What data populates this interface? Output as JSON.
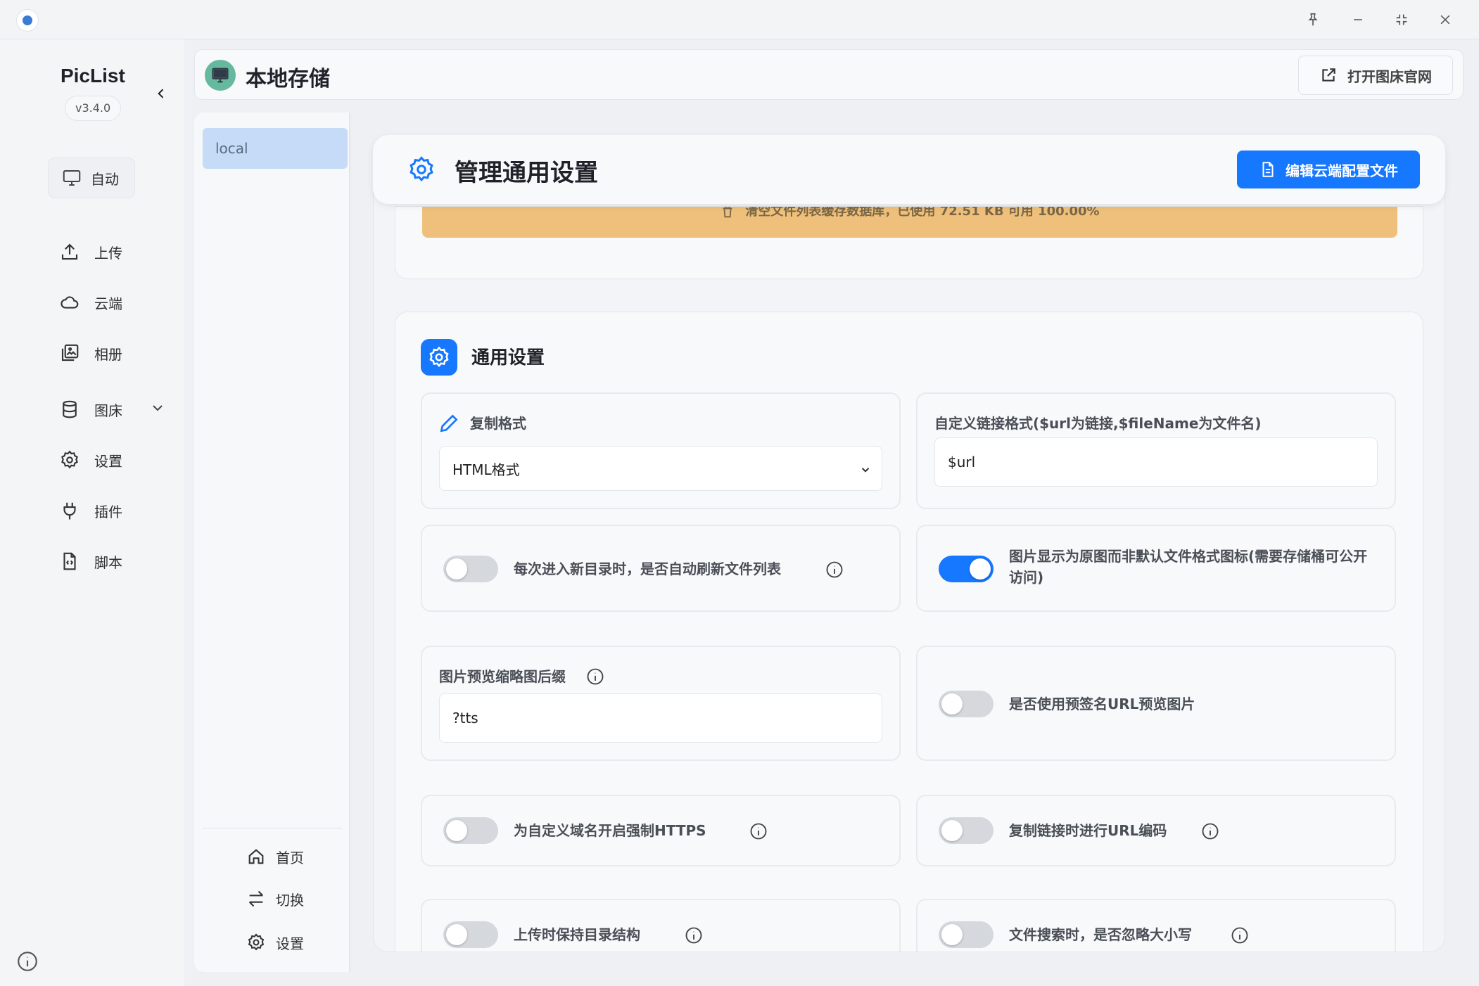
{
  "app": {
    "name": "PicList",
    "version": "v3.4.0",
    "mode_button": "自动"
  },
  "sidebar": {
    "items": [
      {
        "label": "上传",
        "icon": "upload-icon"
      },
      {
        "label": "云端",
        "icon": "cloud-icon"
      },
      {
        "label": "相册",
        "icon": "gallery-icon"
      },
      {
        "label": "图床",
        "icon": "database-icon"
      },
      {
        "label": "设置",
        "icon": "gear-icon"
      },
      {
        "label": "插件",
        "icon": "plug-icon"
      },
      {
        "label": "脚本",
        "icon": "script-icon"
      }
    ]
  },
  "header": {
    "title": "本地存储",
    "open_site_button": "打开图床官网"
  },
  "storage_list": {
    "items": [
      "local"
    ],
    "bottom_buttons": [
      "首页",
      "切换",
      "设置"
    ]
  },
  "main": {
    "title": "管理通用设置",
    "edit_button": "编辑云端配置文件",
    "cache_notice": "清空文件列表缓存数据库，已使用 72.51 KB 可用 100.00%",
    "general": {
      "title": "通用设置",
      "copy_format": {
        "label": "复制格式",
        "value": "HTML格式"
      },
      "custom_link": {
        "label": "自定义链接格式($url为链接,$fileName为文件名)",
        "value": "$url"
      },
      "toggles": {
        "auto_refresh": {
          "label": "每次进入新目录时，是否自动刷新文件列表",
          "on": false
        },
        "show_original": {
          "label": "图片显示为原图而非默认文件格式图标(需要存储桶可公开访问)",
          "on": true
        },
        "presigned": {
          "label": "是否使用预签名URL预览图片",
          "on": false
        },
        "force_https": {
          "label": "为自定义域名开启强制HTTPS",
          "on": false
        },
        "url_encode": {
          "label": "复制链接时进行URL编码",
          "on": false
        },
        "keep_structure": {
          "label": "上传时保持目录结构",
          "on": false
        },
        "ignore_case": {
          "label": "文件搜索时，是否忽略大小写",
          "on": false
        }
      },
      "thumb_suffix": {
        "label": "图片预览缩略图后缀",
        "value": "?tts"
      }
    }
  },
  "colors": {
    "accent": "#1677ff",
    "selected_storage": "#c6dbf7",
    "warning": "#eec07b",
    "header_icon": "#66b99d"
  }
}
